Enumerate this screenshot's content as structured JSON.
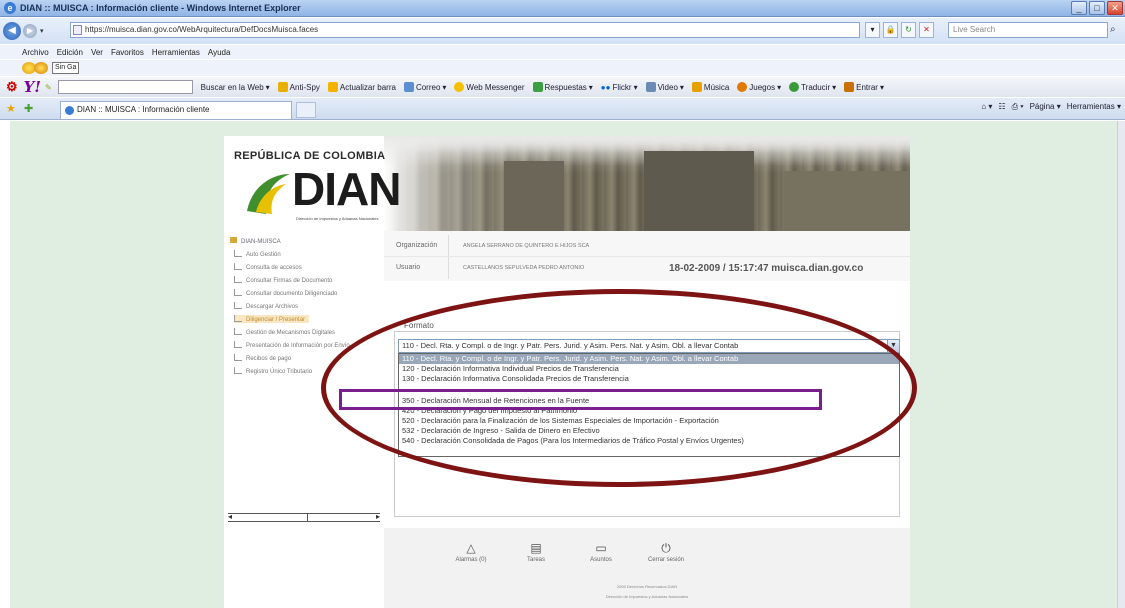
{
  "window": {
    "title": "DIAN :: MUISCA : Información cliente - Windows Internet Explorer"
  },
  "address_bar": {
    "url": "https://muisca.dian.gov.co/WebArquitectura/DefDocsMuisca.faces",
    "search_placeholder": "Live Search"
  },
  "menu": {
    "items": [
      "Archivo",
      "Edición",
      "Ver",
      "Favoritos",
      "Herramientas",
      "Ayuda"
    ]
  },
  "links_bar": {
    "select_label": "Sin Ga"
  },
  "yahoo_toolbar": {
    "logo": "Y!",
    "buscar_label": "Buscar en la Web",
    "items": [
      "Anti-Spy",
      "Actualizar barra",
      "Correo",
      "Web Messenger",
      "Respuestas",
      "Flickr",
      "Video",
      "Música",
      "Juegos",
      "Traducir",
      "Entrar"
    ]
  },
  "tab": {
    "title": "DIAN :: MUISCA : Información cliente"
  },
  "command_bar": {
    "items": [
      "Página",
      "Herramientas"
    ]
  },
  "header": {
    "republica": "REPÚBLICA DE COLOMBIA",
    "logo_text": "DIAN",
    "logo_subtitle": "Dirección de Impuestos y Aduanas Nacionales"
  },
  "sidebar": {
    "root": "DIAN-MUISCA",
    "items": [
      {
        "label": "Auto Gestión",
        "active": false
      },
      {
        "label": "Consulta de accesos",
        "active": false
      },
      {
        "label": "Consultar Firmas de Documento",
        "active": false
      },
      {
        "label": "Consultar documento Diligenciado",
        "active": false
      },
      {
        "label": "Descargar Archivos",
        "active": false
      },
      {
        "label": "Diligenciar / Presentar",
        "active": true
      },
      {
        "label": "Gestión de Mecanismos Digitales",
        "active": false
      },
      {
        "label": "Presentación de Información por Envío",
        "active": false
      },
      {
        "label": "Recibos de pago",
        "active": false
      },
      {
        "label": "Registro Único Tributario",
        "active": false
      }
    ]
  },
  "info": {
    "organizacion_label": "Organización",
    "organizacion_value": "ANGELA SERRANO DE QUINTERO E HIJOS SCA",
    "usuario_label": "Usuario",
    "usuario_value": "CASTELLANOS SEPULVEDA PEDRO ANTONIO",
    "datetime_host": "18-02-2009 / 15:17:47 muisca.dian.gov.co"
  },
  "formato": {
    "label": "Formato",
    "selected": "110 - Decl. Rta. y Compl. o de Ingr. y Patr. Pers. Jurid. y Asim. Pers. Nat. y Asim. Obl. a llevar Contab",
    "options": [
      "110 - Decl. Rta. y Compl. o de Ingr. y Patr. Pers. Jurid. y Asim. Pers. Nat. y Asim. Obl. a llevar Contab",
      "120 - Declaración Informativa Individual Precios de Transferencia",
      "130 - Declaración Informativa Consolidada Precios de Transferencia",
      "",
      "350 - Declaración Mensual de Retenciones en la Fuente",
      "420 - Declaración y Pago del Impuesto al Patrimonio",
      "520 - Declaración para la Finalización de los Sistemas Especiales de Importación - Exportación",
      "532 - Declaración de Ingreso - Salida de Dinero en Efectivo",
      "540 - Declaración Consolidada de Pagos (Para los Intermediarios de Tráfico Postal y Envíos Urgentes)"
    ]
  },
  "footer": {
    "items": [
      "Alarmas (0)",
      "Tareas",
      "Asuntos",
      "Cerrar sesión"
    ],
    "copyright": "2005 Derechos Reservados DIAN",
    "copyright2": "Dirección de Impuestos y Aduanas Nacionales"
  }
}
